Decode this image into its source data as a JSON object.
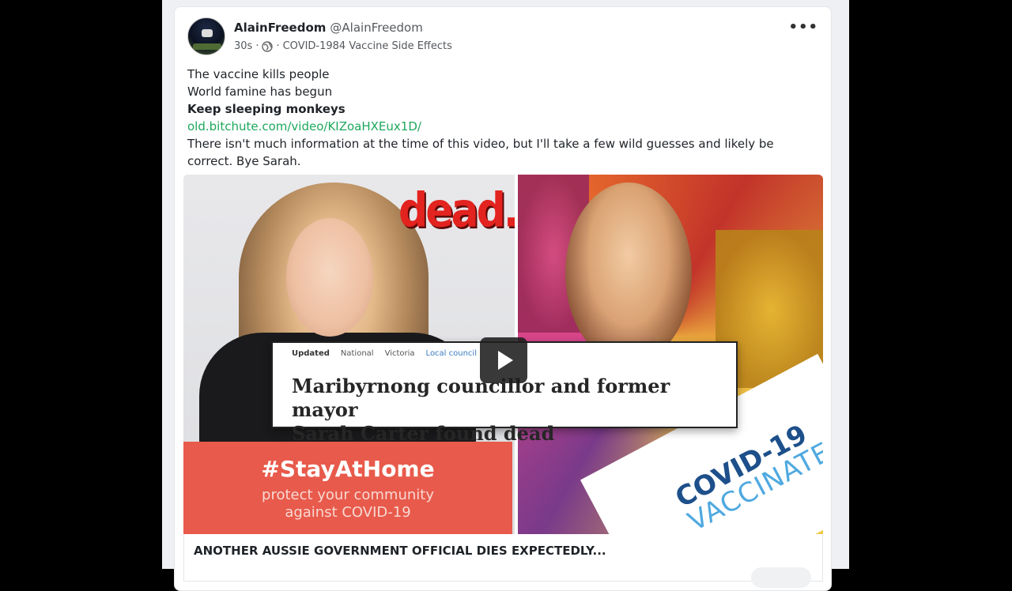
{
  "post": {
    "author_name": "AlainFreedom",
    "author_handle": "@AlainFreedom",
    "time": "30s",
    "separator": "·",
    "channel": "COVID-1984 Vaccine Side Effects",
    "more_label": "•••",
    "lines": {
      "line1": "The vaccine kills people",
      "line2": "World famine has begun",
      "line3": "Keep sleeping monkeys",
      "link": "old.bitchute.com/video/KIZoaHXEux1D/",
      "line4": "There isn't much information at the time of this video, but I'll take a few wild guesses and likely be correct. Bye Sarah."
    }
  },
  "video": {
    "dead_text": "dead.",
    "stay_title": "#StayAtHome",
    "stay_sub1": "protect your community",
    "stay_sub2": "against COVID-19",
    "headline_tags": [
      "Updated",
      "National",
      "Victoria",
      "Local council"
    ],
    "headline_line1": "Maribyrnong councillor and former mayor",
    "headline_line2": "Sarah Carter found dead",
    "covid_line1": "COVID-19",
    "covid_line2": "VACCINATED",
    "caption": "ANOTHER AUSSIE GOVERNMENT OFFICIAL DIES EXPECTEDLY..."
  },
  "colors": {
    "link": "#1da85c",
    "stay_box": "#e85a4b",
    "dead": "#e3231f"
  },
  "icons": {
    "globe": "globe-icon",
    "more": "more-options-icon",
    "play": "play-icon"
  }
}
